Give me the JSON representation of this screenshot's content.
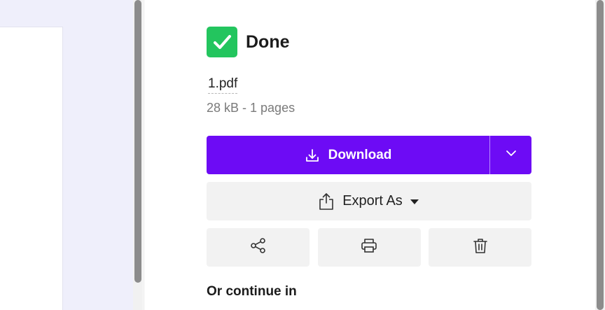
{
  "status": {
    "title": "Done",
    "icon": "check-icon",
    "color": "#23c55e"
  },
  "file": {
    "name": "1.pdf",
    "meta": "28 kB - 1 pages"
  },
  "actions": {
    "download_label": "Download",
    "download_icon": "download-icon",
    "download_more_icon": "chevron-down-icon",
    "export_label": "Export As",
    "export_icon": "export-icon",
    "export_caret_icon": "caret-down-icon",
    "share_icon": "share-icon",
    "print_icon": "print-icon",
    "delete_icon": "trash-icon",
    "accent_color": "#6d0bf5"
  },
  "continue": {
    "label": "Or continue in"
  }
}
